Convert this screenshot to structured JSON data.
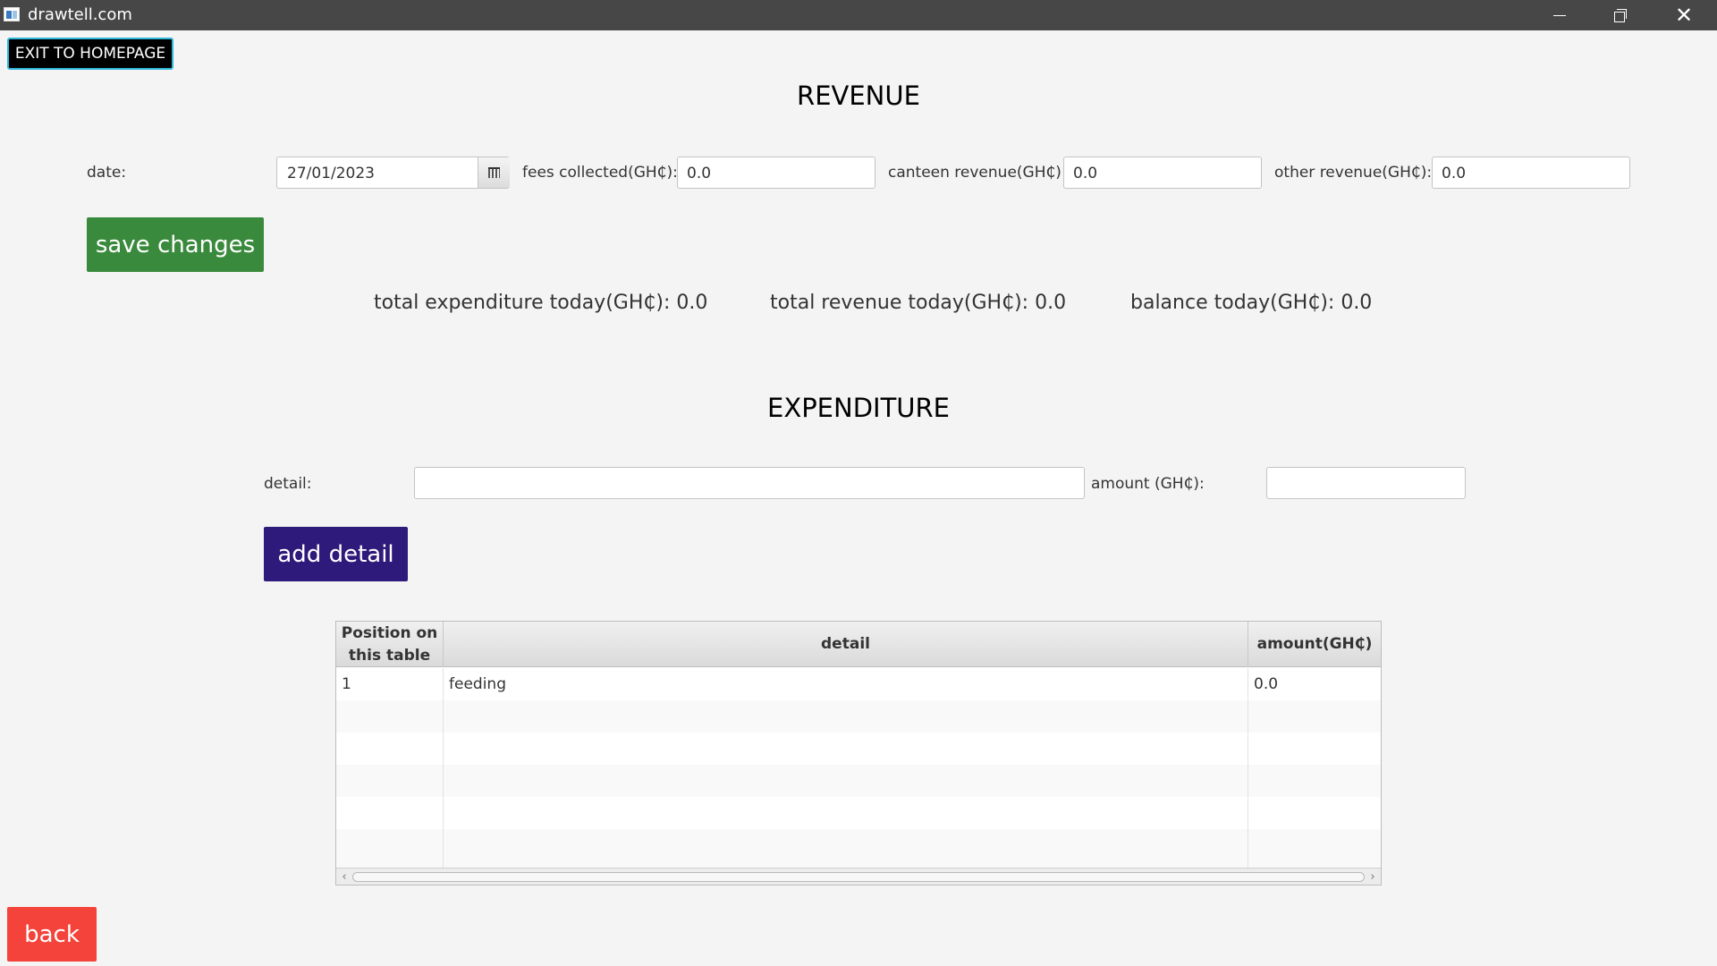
{
  "window": {
    "title": "drawtell.com",
    "close_glyph": "✕"
  },
  "header": {
    "exit_label": "EXIT TO HOMEPAGE"
  },
  "revenue": {
    "heading": "REVENUE",
    "date_label": "date:",
    "date_value": "27/01/2023",
    "fees_label": "fees collected(GH₵):",
    "fees_value": "0.0",
    "canteen_label": "canteen revenue(GH₵):",
    "canteen_value": "0.0",
    "other_label": "other revenue(GH₵):",
    "other_value": "0.0",
    "save_label": "save changes"
  },
  "totals": {
    "expenditure": "total expenditure today(GH₵): 0.0",
    "revenue": "total revenue today(GH₵): 0.0",
    "balance": "balance today(GH₵): 0.0"
  },
  "expenditure": {
    "heading": "EXPENDITURE",
    "detail_label": "detail:",
    "detail_value": "",
    "amount_label": "amount (GH₵):",
    "amount_value": "",
    "add_label": "add detail"
  },
  "table": {
    "columns": [
      "Position on\nthis table",
      "detail",
      "amount(GH₵)"
    ],
    "rows": [
      [
        "1",
        "feeding",
        "0.0"
      ]
    ],
    "scroll_left_glyph": "‹",
    "scroll_right_glyph": "›"
  },
  "footer": {
    "back_label": "back"
  },
  "colors": {
    "save_button": "#3a8a3d",
    "add_button": "#2e1a7a",
    "back_button": "#f4433a",
    "exit_border": "#2fb6d8"
  },
  "icons": [
    "app-icon",
    "calendar-icon",
    "minimize-icon",
    "restore-icon",
    "close-icon"
  ]
}
